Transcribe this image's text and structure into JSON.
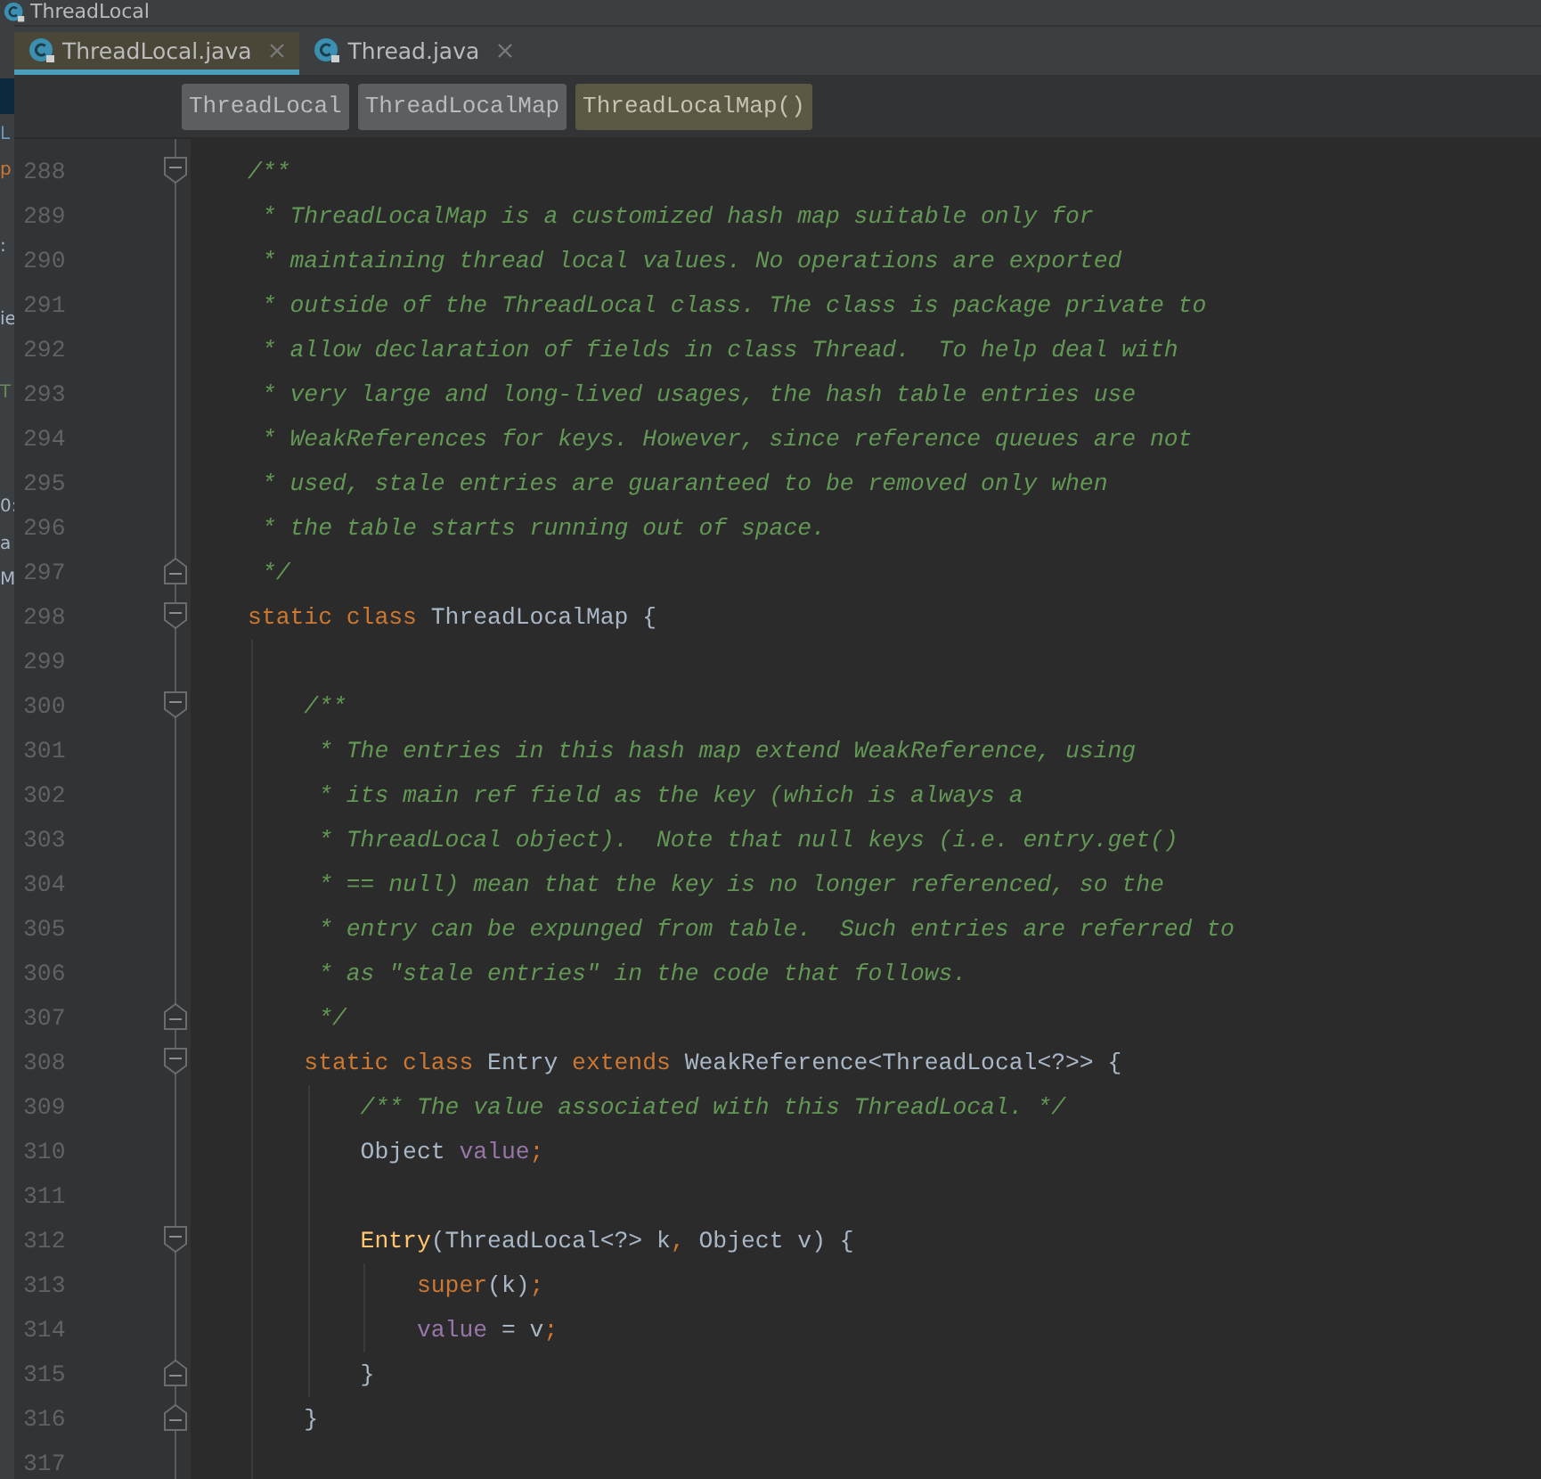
{
  "navigation_bar": {
    "label": "ThreadLocal"
  },
  "side_panel_fragments": [
    {
      "text": "L",
      "color": "#6897bb"
    },
    {
      "text": "p",
      "color": "#cc7832"
    },
    {
      "text": ":",
      "color": "#a9b7c6"
    },
    {
      "text": "ie",
      "color": "#a9b7c6"
    },
    {
      "text": "T",
      "color": "#6a8759"
    },
    {
      "text": "0:",
      "color": "#a9b7c6"
    },
    {
      "text": "a",
      "color": "#a9b7c6"
    },
    {
      "text": "M",
      "color": "#a9b7c6"
    }
  ],
  "tabs": [
    {
      "label": "ThreadLocal.java",
      "selected": true
    },
    {
      "label": "Thread.java",
      "selected": false
    }
  ],
  "breadcrumbs": [
    {
      "label": "ThreadLocal",
      "selected": false
    },
    {
      "label": "ThreadLocalMap",
      "selected": false
    },
    {
      "label": "ThreadLocalMap()",
      "selected": true
    }
  ],
  "lines": [
    {
      "number": "288",
      "fold_start": true,
      "fold_end": false,
      "tokens": [
        {
          "kind": "doc",
          "text": "/**"
        }
      ]
    },
    {
      "number": "289",
      "fold_start": false,
      "fold_end": false,
      "tokens": [
        {
          "kind": "doc",
          "text": " * ThreadLocalMap is a customized hash map suitable only for"
        }
      ]
    },
    {
      "number": "290",
      "fold_start": false,
      "fold_end": false,
      "tokens": [
        {
          "kind": "doc",
          "text": " * maintaining thread local values. No operations are exported"
        }
      ]
    },
    {
      "number": "291",
      "fold_start": false,
      "fold_end": false,
      "tokens": [
        {
          "kind": "doc",
          "text": " * outside of the ThreadLocal class. The class is package private to"
        }
      ]
    },
    {
      "number": "292",
      "fold_start": false,
      "fold_end": false,
      "tokens": [
        {
          "kind": "doc",
          "text": " * allow declaration of fields in class Thread.  To help deal with"
        }
      ]
    },
    {
      "number": "293",
      "fold_start": false,
      "fold_end": false,
      "tokens": [
        {
          "kind": "doc",
          "text": " * very large and long-lived usages, the hash table entries use"
        }
      ]
    },
    {
      "number": "294",
      "fold_start": false,
      "fold_end": false,
      "tokens": [
        {
          "kind": "doc",
          "text": " * WeakReferences for keys. However, since reference queues are not"
        }
      ]
    },
    {
      "number": "295",
      "fold_start": false,
      "fold_end": false,
      "tokens": [
        {
          "kind": "doc",
          "text": " * used, stale entries are guaranteed to be removed only when"
        }
      ]
    },
    {
      "number": "296",
      "fold_start": false,
      "fold_end": false,
      "tokens": [
        {
          "kind": "doc",
          "text": " * the table starts running out of space."
        }
      ]
    },
    {
      "number": "297",
      "fold_start": false,
      "fold_end": true,
      "tokens": [
        {
          "kind": "doc",
          "text": " */"
        }
      ]
    },
    {
      "number": "298",
      "fold_start": true,
      "fold_end": false,
      "tokens": [
        {
          "kind": "keyword",
          "text": "static class "
        },
        {
          "kind": "plain",
          "text": "ThreadLocalMap {"
        }
      ]
    },
    {
      "number": "299",
      "fold_start": false,
      "fold_end": false
    },
    {
      "number": "300",
      "fold_start": true,
      "fold_end": false,
      "tokens": [
        {
          "kind": "doc",
          "text": "    /**"
        }
      ]
    },
    {
      "number": "301",
      "fold_start": false,
      "fold_end": false,
      "tokens": [
        {
          "kind": "doc",
          "text": "     * The entries in this hash map extend WeakReference, using"
        }
      ]
    },
    {
      "number": "302",
      "fold_start": false,
      "fold_end": false,
      "tokens": [
        {
          "kind": "doc",
          "text": "     * its main ref field as the key (which is always a"
        }
      ]
    },
    {
      "number": "303",
      "fold_start": false,
      "fold_end": false,
      "tokens": [
        {
          "kind": "doc",
          "text": "     * ThreadLocal object).  Note that null keys (i.e. entry.get()"
        }
      ]
    },
    {
      "number": "304",
      "fold_start": false,
      "fold_end": false,
      "tokens": [
        {
          "kind": "doc",
          "text": "     * == null) mean that the key is no longer referenced, so the"
        }
      ]
    },
    {
      "number": "305",
      "fold_start": false,
      "fold_end": false,
      "tokens": [
        {
          "kind": "doc",
          "text": "     * entry can be expunged from table.  Such entries are referred to"
        }
      ]
    },
    {
      "number": "306",
      "fold_start": false,
      "fold_end": false,
      "tokens": [
        {
          "kind": "doc",
          "text": "     * as \"stale entries\" in the code that follows."
        }
      ]
    },
    {
      "number": "307",
      "fold_start": false,
      "fold_end": true,
      "tokens": [
        {
          "kind": "doc",
          "text": "     */"
        }
      ]
    },
    {
      "number": "308",
      "fold_start": true,
      "fold_end": false,
      "tokens": [
        {
          "kind": "keyword",
          "text": "    static class "
        },
        {
          "kind": "plain",
          "text": "Entry "
        },
        {
          "kind": "keyword",
          "text": "extends "
        },
        {
          "kind": "plain",
          "text": "WeakReference<ThreadLocal<?>> {"
        }
      ]
    },
    {
      "number": "309",
      "fold_start": false,
      "fold_end": false,
      "tokens": [
        {
          "kind": "doc",
          "text": "        /** The value associated with this ThreadLocal. */"
        }
      ]
    },
    {
      "number": "310",
      "fold_start": false,
      "fold_end": false,
      "tokens": [
        {
          "kind": "plain",
          "text": "        Object "
        },
        {
          "kind": "field",
          "text": "value"
        },
        {
          "kind": "punct",
          "text": ";"
        }
      ]
    },
    {
      "number": "311",
      "fold_start": false,
      "fold_end": false
    },
    {
      "number": "312",
      "fold_start": true,
      "fold_end": false,
      "tokens": [
        {
          "kind": "method",
          "text": "        Entry"
        },
        {
          "kind": "plain",
          "text": "(ThreadLocal<?> k"
        },
        {
          "kind": "punct",
          "text": ","
        },
        {
          "kind": "plain",
          "text": " Object v) {"
        }
      ]
    },
    {
      "number": "313",
      "fold_start": false,
      "fold_end": false,
      "tokens": [
        {
          "kind": "keyword",
          "text": "            super"
        },
        {
          "kind": "plain",
          "text": "(k)"
        },
        {
          "kind": "punct",
          "text": ";"
        }
      ]
    },
    {
      "number": "314",
      "fold_start": false,
      "fold_end": false,
      "tokens": [
        {
          "kind": "field",
          "text": "            value"
        },
        {
          "kind": "plain",
          "text": " = v"
        },
        {
          "kind": "punct",
          "text": ";"
        }
      ]
    },
    {
      "number": "315",
      "fold_start": false,
      "fold_end": true,
      "tokens": [
        {
          "kind": "plain",
          "text": "        }"
        }
      ]
    },
    {
      "number": "316",
      "fold_start": false,
      "fold_end": true,
      "tokens": [
        {
          "kind": "plain",
          "text": "    }"
        }
      ]
    },
    {
      "number": "317",
      "fold_start": false,
      "fold_end": false
    }
  ]
}
